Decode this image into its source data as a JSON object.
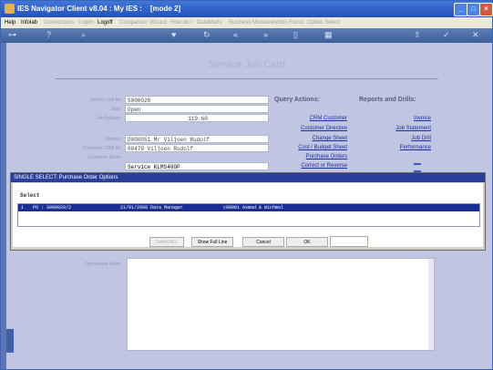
{
  "window": {
    "title": "IES Navigator Client v8.04 : My IES :",
    "mode": "[mode 2]",
    "controls": [
      "_",
      "□",
      "×"
    ]
  },
  "menubar": {
    "items": [
      {
        "label": "Help",
        "enabled": true
      },
      {
        "label": "Infolab",
        "enabled": true
      },
      {
        "label": "Connections",
        "enabled": false
      },
      {
        "label": "Logon",
        "enabled": false
      },
      {
        "label": "Logoff",
        "enabled": true
      },
      {
        "label": "Companion",
        "enabled": false
      },
      {
        "label": "Wizard",
        "enabled": false
      },
      {
        "label": "How do I",
        "enabled": false
      },
      {
        "label": "DataMarts",
        "enabled": false
      },
      {
        "label": "Business Modules",
        "enabled": false
      },
      {
        "label": "Action Focus",
        "enabled": false
      },
      {
        "label": "Option Select",
        "enabled": false
      }
    ]
  },
  "toolbar": {
    "icons": [
      "key-icon",
      "help-icon",
      "search-icon",
      "heart-icon",
      "refresh-icon",
      "back-icon",
      "forward-icon",
      "document-icon",
      "save-icon",
      "export-icon",
      "check-icon",
      "close-icon"
    ]
  },
  "form": {
    "title": "Service Job Card",
    "fields": [
      {
        "label": "Service Job No",
        "value": "S000026"
      },
      {
        "label": "State",
        "value": "Open"
      },
      {
        "label": "Job Balance",
        "value": "119.60"
      },
      {
        "label": "Director",
        "value": "D000051 Mr Viljoen Rudolf"
      },
      {
        "label": "Customer CRM No",
        "value": "00479 Viljoen Rudolf"
      },
      {
        "label": "Customer Name",
        "value": "Service KLMS400P"
      }
    ],
    "operational_notes_label": "Operational Notes"
  },
  "query_actions": {
    "heading": "Query Actions:",
    "links": [
      "CRM Customer",
      "Customer Directive",
      "Change Sheet",
      "Cost / Budget Sheet",
      "Purchase Orders",
      "Correct or Reverse"
    ]
  },
  "reports": {
    "heading": "Reports and Drills:",
    "links": [
      "Invoice",
      "Job Statement",
      "Job Drill",
      "Performance"
    ]
  },
  "dialog": {
    "title": "SINGLE SELECT: Purchase Order Options",
    "select_label": "Select",
    "rows": [
      {
        "num": "1",
        "col1": "PO : S000020/2",
        "col2": "21/01/2008 Data Manager",
        "col3": "c00001 Asmad & Wichmal"
      }
    ],
    "buttons": {
      "select_all": "Select ALL",
      "show_full_line": "Show Full Line",
      "cancel": "Cancel",
      "ok": "OK"
    },
    "input_value": ""
  },
  "colors": {
    "title_bar": "#2a58c0",
    "dialog_title": "#2a3f9a",
    "selection": "#1a2f94",
    "background": "#c0c6e2",
    "link": "#1b2f9e"
  }
}
